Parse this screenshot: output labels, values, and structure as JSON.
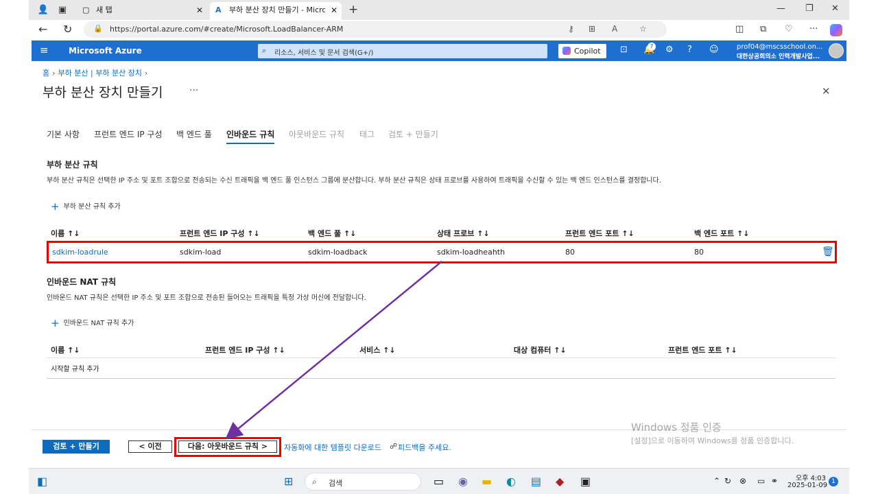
{
  "browser": {
    "tabs": [
      {
        "label": "새 탭",
        "close": "✕"
      },
      {
        "label": "부하 분산 장치 만들기 - Microsoft",
        "close": "✕"
      }
    ],
    "new_tab": "+",
    "window_controls": [
      "—",
      "❐",
      "✕"
    ],
    "url": "https://portal.azure.com/#create/Microsoft.LoadBalancer-ARM"
  },
  "azure": {
    "brand": "Microsoft Azure",
    "search_placeholder": "리소스, 서비스 및 문서 검색(G+/)",
    "copilot": "Copilot",
    "notifications_count": "7",
    "account_email": "prof04@mscsschool.on...",
    "account_org": "대한상공회의소 인력개발사업..."
  },
  "breadcrumb": [
    "홈",
    "부하 분산 | 부하 분산 장치"
  ],
  "page_title": "부하 분산 장치 만들기",
  "more": "···",
  "wizard_tabs": [
    {
      "label": "기본 사항",
      "state": "normal"
    },
    {
      "label": "프런트 엔드 IP 구성",
      "state": "normal"
    },
    {
      "label": "백 엔드 풀",
      "state": "normal"
    },
    {
      "label": "인바운드 규칙",
      "state": "active"
    },
    {
      "label": "아웃바운드 규칙",
      "state": "disabled"
    },
    {
      "label": "태그",
      "state": "disabled"
    },
    {
      "label": "검토 + 만들기",
      "state": "disabled"
    }
  ],
  "lb_rules": {
    "heading": "부하 분산 규칙",
    "description": "부하 분산 규칙은 선택한 IP 주소 및 포트 조합으로 전송되는 수신 트래픽을 백 엔드 풀 인스턴스 그룹에 분산합니다. 부하 분산 규칙은 상태 프로브를 사용하여 트래픽을 수신할 수 있는 백 엔드 인스턴스를 결정합니다.",
    "add_label": "부하 분산 규칙 추가",
    "columns": [
      "이름 ↑↓",
      "프런트 엔드 IP 구성 ↑↓",
      "백 엔드 풀 ↑↓",
      "상태 프로브 ↑↓",
      "프런트 엔드 포트 ↑↓",
      "백 엔드 포트 ↑↓"
    ],
    "rows": [
      [
        "sdkim-loadrule",
        "sdkim-load",
        "sdkim-loadback",
        "sdkim-loadheahth",
        "80",
        "80"
      ]
    ]
  },
  "nat_rules": {
    "heading": "인바운드 NAT 규칙",
    "description": "인바운드 NAT 규칙은 선택한 IP 주소 및 포트 조합으로 전송된 들어오는 트래픽을 특정 가상 머신에 전달합니다.",
    "add_label": "인바운드 NAT 규칙 추가",
    "columns": [
      "이름 ↑↓",
      "프런트 엔드 IP 구성 ↑↓",
      "서비스 ↑↓",
      "대상 컴퓨터 ↑↓",
      "프런트 엔드 포트 ↑↓"
    ],
    "empty_text": "시작할 규칙 추가"
  },
  "footer": {
    "review_create": "검토 + 만들기",
    "previous": "< 이전",
    "next": "다음: 아웃바운드 규칙 >",
    "download_template": "자동화에 대한 템플릿 다운로드",
    "feedback": "피드백을 주세요."
  },
  "watermark": {
    "line1": "Windows 정품 인증",
    "line2": "[설정]으로 이동하여 Windows를 정품 인증합니다."
  },
  "taskbar": {
    "search": "검색",
    "time": "오후 4:03",
    "date": "2025-01-09",
    "notification_count": "1"
  },
  "colors": {
    "azure_blue": "#1f6fd1",
    "link": "#0f6cbd",
    "highlight_red": "#e00000",
    "arrow_purple": "#7030a0"
  }
}
